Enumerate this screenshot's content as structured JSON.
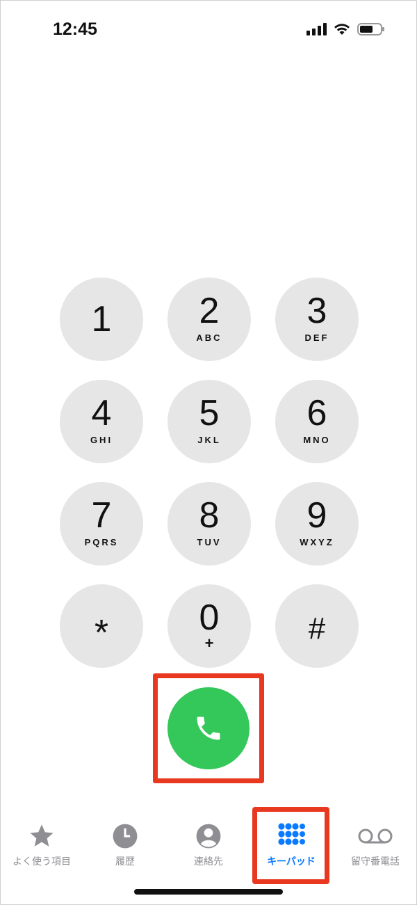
{
  "status_bar": {
    "time": "12:45"
  },
  "keypad": {
    "keys": [
      {
        "digit": "1",
        "letters": ""
      },
      {
        "digit": "2",
        "letters": "ABC"
      },
      {
        "digit": "3",
        "letters": "DEF"
      },
      {
        "digit": "4",
        "letters": "GHI"
      },
      {
        "digit": "5",
        "letters": "JKL"
      },
      {
        "digit": "6",
        "letters": "MNO"
      },
      {
        "digit": "7",
        "letters": "PQRS"
      },
      {
        "digit": "8",
        "letters": "TUV"
      },
      {
        "digit": "9",
        "letters": "WXYZ"
      },
      {
        "digit": "*",
        "letters": ""
      },
      {
        "digit": "0",
        "letters": "+"
      },
      {
        "digit": "#",
        "letters": ""
      }
    ]
  },
  "call": {
    "icon": "phone-icon",
    "color": "#34c759"
  },
  "tab_bar": {
    "tabs": [
      {
        "label": "よく使う項目",
        "icon": "star-icon"
      },
      {
        "label": "履歴",
        "icon": "clock-icon"
      },
      {
        "label": "連絡先",
        "icon": "person-icon"
      },
      {
        "label": "キーパッド",
        "icon": "keypad-icon"
      },
      {
        "label": "留守番電話",
        "icon": "voicemail-icon"
      }
    ],
    "active_color": "#0a7aff",
    "inactive_color": "#8e8e93"
  },
  "highlight_color": "#e8381f"
}
